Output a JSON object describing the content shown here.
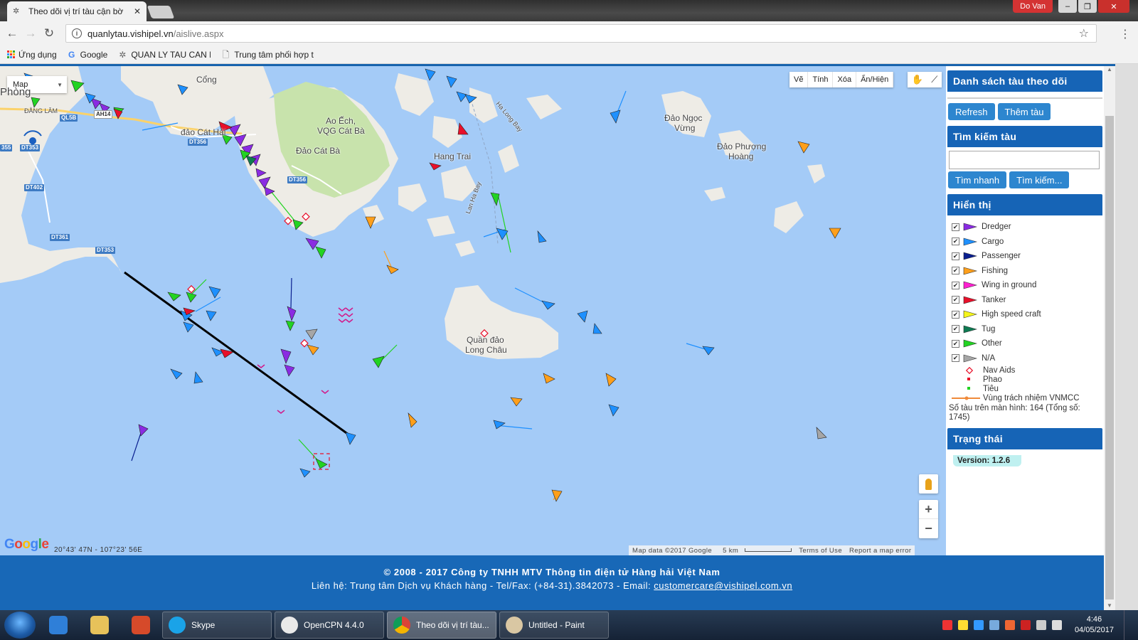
{
  "browser": {
    "tab_title": "Theo dõi vị trí tàu cận bờ",
    "user_label": "Do Van",
    "url_host": "quanlytau.vishipel.vn",
    "url_path": "/aislive.aspx",
    "bookmarks": [
      {
        "label": "Ứng dụng",
        "icon": "apps-grid-icon"
      },
      {
        "label": "Google",
        "icon": "google-icon"
      },
      {
        "label": "QUAN LY TAU CAN B",
        "icon": "bookmark-page-icon"
      },
      {
        "label": "Trung tâm phối hợp t",
        "icon": "document-icon"
      }
    ]
  },
  "map": {
    "type_selector": "Map",
    "draw_tools": [
      "Vẽ",
      "Tính",
      "Xóa",
      "Ẩn/Hiện"
    ],
    "places": {
      "cong": "Cổng",
      "phong": "Phòng",
      "dang_lam": "ĐẰNG LÂM",
      "cat_hai": "đảo Cát Hải",
      "ao_ech": "Ao Ếch,",
      "vqg": "VQG Cát Bà",
      "cat_ba": "Đảo Cát Bà",
      "hang_trai": "Hang Trai",
      "ha_long_bay": "Ha Long Bay",
      "lan_ha_bay": "Lan Ha Bay",
      "ngoc_vung_1": "Đảo Ngọc",
      "ngoc_vung_2": "Vừng",
      "phuong_hoang_1": "Đảo Phượng",
      "phuong_hoang_2": "Hoàng",
      "long_chau_1": "Quần đảo",
      "long_chau_2": "Long Châu"
    },
    "roads": {
      "ql5b": "QL5B",
      "ah14": "AH14",
      "dt356a": "DT356",
      "dt356b": "DT356",
      "dt355": "355",
      "dt353": "DT353",
      "dt402": "DT402",
      "dt361": "DT361",
      "dt353b": "DT353"
    },
    "google": "Google",
    "coordinates": "20°43' 47N - 107°23' 56E",
    "attribution": {
      "map_data": "Map data ©2017 Google",
      "scale": "5 km",
      "terms": "Terms of Use",
      "report": "Report a map error"
    }
  },
  "sidebar": {
    "watchlist_title": "Danh sách tàu theo dõi",
    "refresh_label": "Refresh",
    "add_ship_label": "Thêm tàu",
    "search_title": "Tìm kiếm tàu",
    "search_value": "",
    "quick_search_label": "Tìm nhanh",
    "search_label": "Tìm kiếm...",
    "display_title": "Hiển thị",
    "ship_types": [
      {
        "label": "Dredger",
        "color": "#8a2be2"
      },
      {
        "label": "Cargo",
        "color": "#1e90ff"
      },
      {
        "label": "Passenger",
        "color": "#0a1f8f"
      },
      {
        "label": "Fishing",
        "color": "#ff9f1a"
      },
      {
        "label": "Wing in ground",
        "color": "#ff1fd0"
      },
      {
        "label": "Tanker",
        "color": "#e8102a"
      },
      {
        "label": "High speed craft",
        "color": "#f5f51a"
      },
      {
        "label": "Tug",
        "color": "#0e7a52"
      },
      {
        "label": "Other",
        "color": "#22d322"
      },
      {
        "label": "N/A",
        "color": "#a6a6a6"
      }
    ],
    "extra_legend": [
      {
        "label": "Nav Aids"
      },
      {
        "label": "Phao"
      },
      {
        "label": "Tiêu"
      },
      {
        "label": "Vùng trách nhiệm VNMCC"
      }
    ],
    "ship_count": "Số tàu trên màn hình: 164 (Tổng số: 1745)",
    "status_title": "Trạng thái",
    "version": "Version: 1.2.6"
  },
  "footer": {
    "copyright": "© 2008 - 2017 Công ty TNHH MTV Thông tin điện tử Hàng hải Việt Nam",
    "contact_prefix": "Liên hệ: Trung tâm Dịch vụ Khách hàng - Tel/Fax: (+84-31).3842073 - Email: ",
    "email": "customercare@vishipel.com.vn"
  },
  "taskbar": {
    "tasks": [
      {
        "label": "Skype"
      },
      {
        "label": "OpenCPN 4.4.0"
      },
      {
        "label": "Theo dõi vị trí tàu..."
      },
      {
        "label": "Untitled - Paint"
      }
    ],
    "time": "4:46",
    "date": "04/05/2017"
  }
}
